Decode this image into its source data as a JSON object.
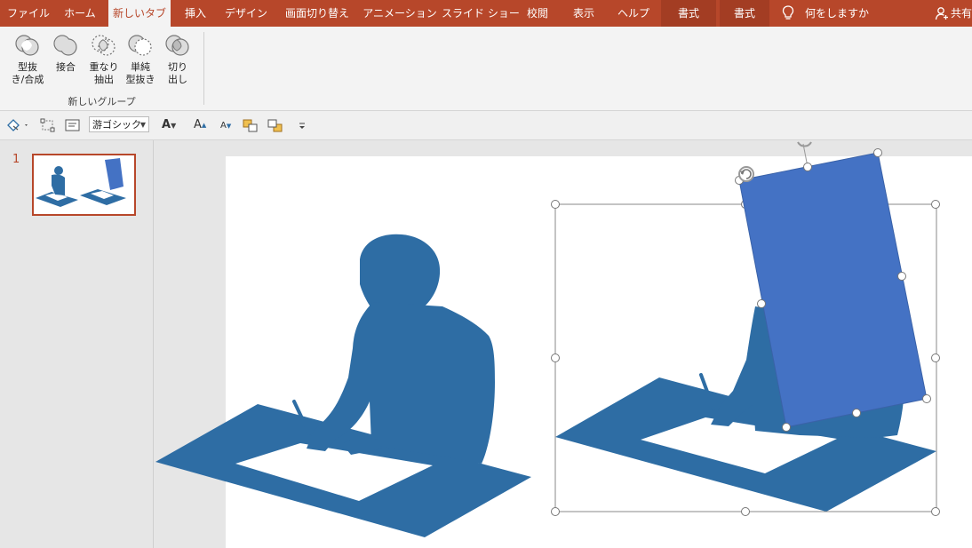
{
  "ribbon": {
    "tabs": [
      {
        "label": "ファイル"
      },
      {
        "label": "ホーム"
      },
      {
        "label": "新しいタブ"
      },
      {
        "label": "挿入"
      },
      {
        "label": "デザイン"
      },
      {
        "label": "画面切り替え"
      },
      {
        "label": "アニメーション"
      },
      {
        "label": "スライド ショー"
      },
      {
        "label": "校閲"
      },
      {
        "label": "表示"
      },
      {
        "label": "ヘルプ"
      },
      {
        "label": "書式"
      },
      {
        "label": "書式"
      }
    ],
    "tell_me": "何をしますか",
    "share": "共有",
    "buttons": [
      {
        "line1": "型抜",
        "line2": "き/合成"
      },
      {
        "line1": "接合",
        "line2": ""
      },
      {
        "line1": "重なり",
        "line2": "抽出"
      },
      {
        "line1": "単純",
        "line2": "型抜き"
      },
      {
        "line1": "切り",
        "line2": "出し"
      }
    ],
    "group_label": "新しいグループ"
  },
  "toolbar": {
    "font_name": "游ゴシック",
    "font_color_glyph": "A",
    "grow_glyph": "A",
    "shrink_glyph": "A"
  },
  "thumbnails": {
    "slide_number": "1"
  },
  "colors": {
    "ribbon": "#b7472a",
    "silhouette": "#2e6da4",
    "rectangle": "#4472c4"
  }
}
